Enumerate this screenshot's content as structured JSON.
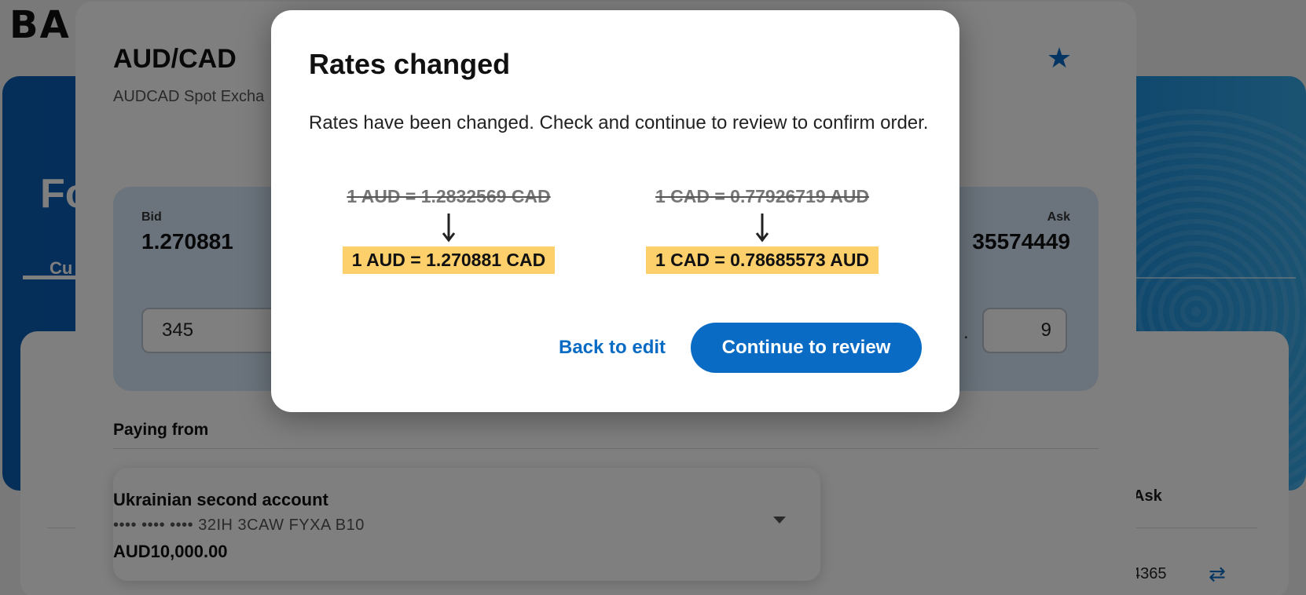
{
  "background": {
    "brand": "BA",
    "hero_title": "Fo",
    "hero_tab": "Cu",
    "ask_header": "Ask",
    "rate_value": "4365"
  },
  "panel": {
    "pair_title": "AUD/CAD",
    "pair_subtitle": "AUDCAD Spot Excha",
    "bid_label": "Bid",
    "bid_value": "1.270881",
    "ask_label": "Ask",
    "ask_value": "35574449",
    "amount_value": "345",
    "dot_text": ".",
    "small_value": "9",
    "paying_from_label": "Paying from",
    "account": {
      "name": "Ukrainian second account",
      "number": "•••• •••• •••• 32IH 3CAW FYXA B10",
      "balance": "AUD10,000.00"
    }
  },
  "modal": {
    "title": "Rates changed",
    "body": "Rates have been changed. Check and continue to review to confirm order.",
    "rates": [
      {
        "old": "1 AUD = 1.2832569 CAD",
        "new": "1 AUD = 1.270881 CAD"
      },
      {
        "old": "1 CAD = 0.77926719 AUD",
        "new": "1 CAD = 0.78685573 AUD"
      }
    ],
    "back_label": "Back to edit",
    "continue_label": "Continue to review"
  },
  "colors": {
    "accent": "#0a6bc4",
    "highlight": "#fdd06c"
  }
}
